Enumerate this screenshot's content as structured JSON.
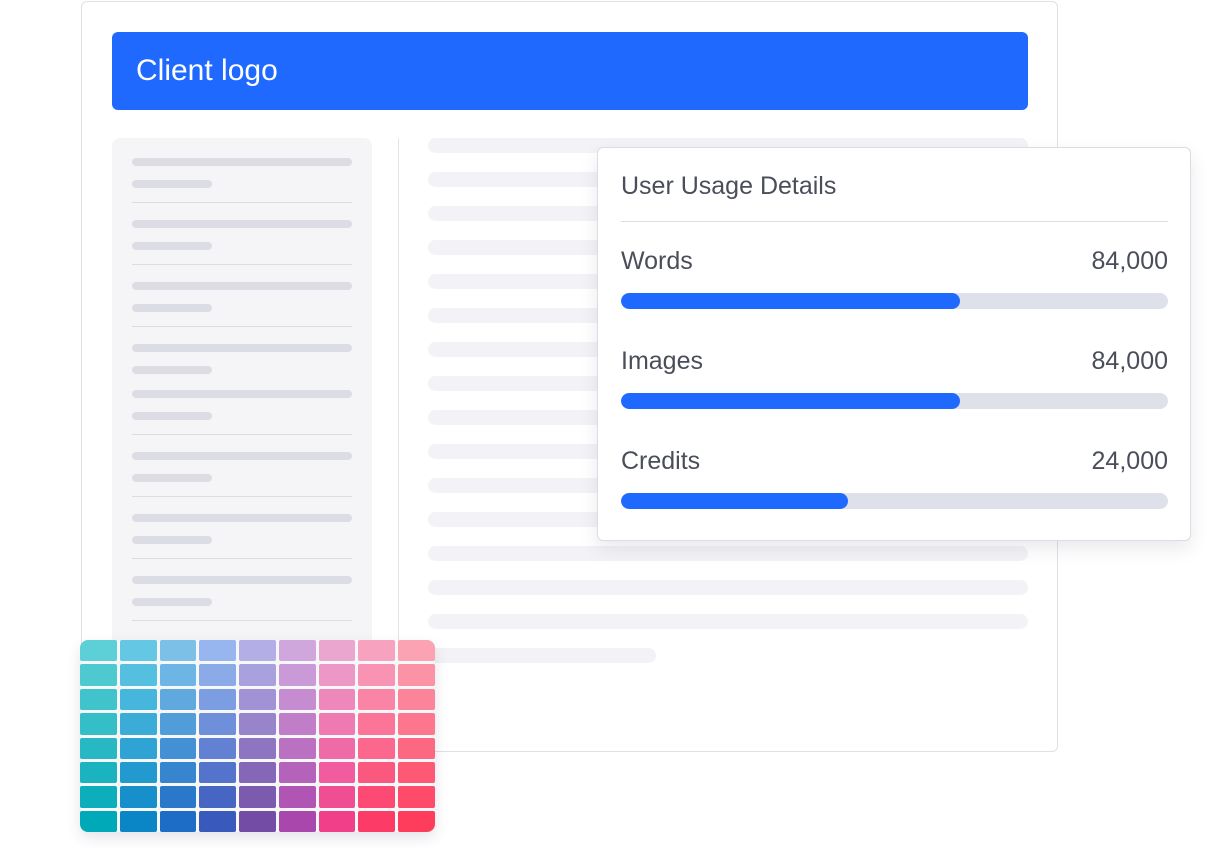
{
  "header": {
    "logo_text": "Client logo",
    "accent_color": "#1f69ff"
  },
  "usage_card": {
    "title": "User Usage Details",
    "metrics": [
      {
        "label": "Words",
        "value": "84,000",
        "progress": 0.62
      },
      {
        "label": "Images",
        "value": "84,000",
        "progress": 0.62
      },
      {
        "label": "Credits",
        "value": "24,000",
        "progress": 0.415
      }
    ]
  },
  "palette": {
    "rows": [
      [
        "#5dcfd6",
        "#64c8e4",
        "#7cc0e8",
        "#97b6ef",
        "#b3aee6",
        "#cfa7dd",
        "#eba6cf",
        "#f7a3bf",
        "#fba3b3"
      ],
      [
        "#4ec9d0",
        "#55bfe0",
        "#6db5e4",
        "#8aaae8",
        "#a9a0de",
        "#c99ad7",
        "#ec97c5",
        "#f993b3",
        "#fb92a6"
      ],
      [
        "#40c3cb",
        "#47b6dc",
        "#5fa9df",
        "#7c9de2",
        "#a092d4",
        "#c58ccf",
        "#ee88bb",
        "#fa84a6",
        "#fb849a"
      ],
      [
        "#34bec7",
        "#3bacd8",
        "#519dda",
        "#6f8fda",
        "#9784cb",
        "#c07ec8",
        "#ef79b1",
        "#fb7599",
        "#fc768d"
      ],
      [
        "#27b8c3",
        "#2fa3d4",
        "#4490d4",
        "#6281d2",
        "#8e75c1",
        "#bb71c1",
        "#ef6ba7",
        "#fb678d",
        "#fc6881"
      ],
      [
        "#1ab3bf",
        "#2299cf",
        "#3784cf",
        "#5474cb",
        "#8567b8",
        "#b563ba",
        "#f05c9d",
        "#fb5880",
        "#fd5975"
      ],
      [
        "#0daebb",
        "#168fcb",
        "#2a78ca",
        "#4766c3",
        "#7c5aae",
        "#b055b3",
        "#f04e93",
        "#fc4a74",
        "#fd4b69"
      ],
      [
        "#00a9b8",
        "#0a86c7",
        "#1d6cc5",
        "#3a59bc",
        "#734ca5",
        "#aa47ac",
        "#f13f89",
        "#fc3c67",
        "#fe3d5c"
      ]
    ]
  }
}
